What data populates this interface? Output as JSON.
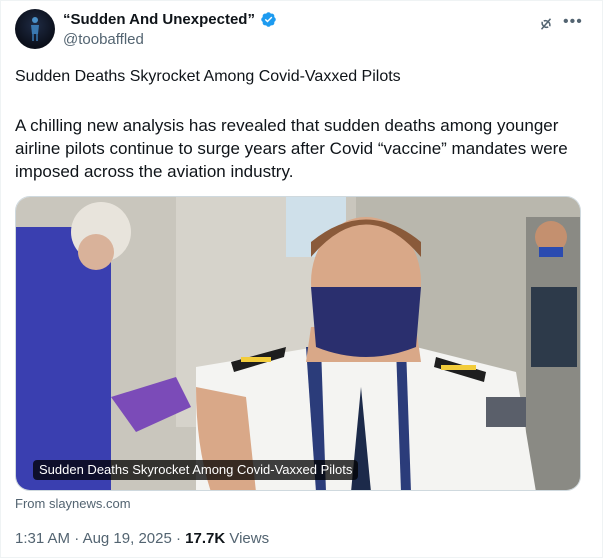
{
  "author": {
    "display_name": "“Sudden And Unexpected”",
    "handle": "@toobaffled",
    "verified": true,
    "avatar_icon": "avatar-icon"
  },
  "header_icons": {
    "grok": "grok-icon",
    "more": "more-icon"
  },
  "post": {
    "headline": "Sudden Deaths Skyrocket Among Covid-Vaxxed Pilots",
    "body": "A chilling new analysis has revealed that sudden deaths among younger airline pilots continue to surge years after Covid “vaccine” mandates were imposed across the aviation industry."
  },
  "card": {
    "caption": "Sudden Deaths Skyrocket Among Covid-Vaxxed Pilots",
    "source": "From slaynews.com"
  },
  "meta": {
    "time": "1:31 AM",
    "separator": " · ",
    "date": "Aug 19, 2025",
    "views_count": "17.7K",
    "views_label": " Views"
  },
  "colors": {
    "verified_badge": "#1d9bf0",
    "secondary_text": "#536471",
    "primary_text": "#0f1419"
  }
}
